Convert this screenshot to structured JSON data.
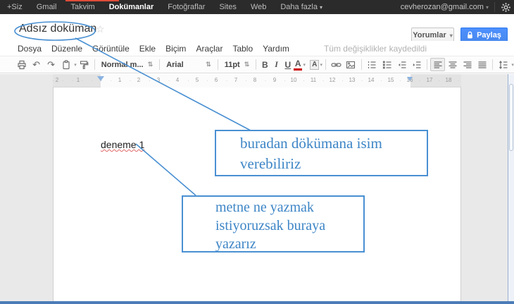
{
  "topbar": {
    "items": [
      "+Siz",
      "Gmail",
      "Takvim",
      "Dokümanlar",
      "Fotoğraflar",
      "Sites",
      "Web",
      "Daha fazla"
    ],
    "active_item": "Dokümanlar",
    "account_email": "cevherozan@gmail.com"
  },
  "header": {
    "doc_title": "Adsız doküman",
    "comments_label": "Yorumlar",
    "share_label": "Paylaş"
  },
  "menubar": {
    "items": [
      "Dosya",
      "Düzenle",
      "Görüntüle",
      "Ekle",
      "Biçim",
      "Araçlar",
      "Tablo",
      "Yardım"
    ],
    "save_status": "Tüm değişiklikler kaydedildi"
  },
  "toolbar": {
    "style_value": "Normal m...",
    "font_value": "Arial",
    "size_value": "11pt",
    "bold_label": "B",
    "italic_label": "I",
    "underline_label": "U",
    "text_color_label": "A",
    "highlight_label": "A"
  },
  "ruler": {
    "left_marks": [
      "2",
      "1"
    ],
    "marks": [
      "1",
      "2",
      "3",
      "4",
      "5",
      "6",
      "7",
      "8",
      "9",
      "10",
      "11",
      "12",
      "13",
      "14",
      "15",
      "16",
      "17",
      "18"
    ]
  },
  "document": {
    "body_text": "deneme 1"
  },
  "annotations": {
    "note_title": "buradan dökümana isim verebiliriz",
    "note_body": "metne ne yazmak istiyoruzsak buraya yazarız"
  },
  "icons": {
    "caret_down": "▾",
    "spinner": "⇅",
    "star": "☆",
    "undo": "↶",
    "redo": "↷"
  },
  "colors": {
    "annotation_blue": "#4a90d2",
    "share_button_blue": "#4d90fe",
    "topbar_red": "#dd4b39"
  }
}
